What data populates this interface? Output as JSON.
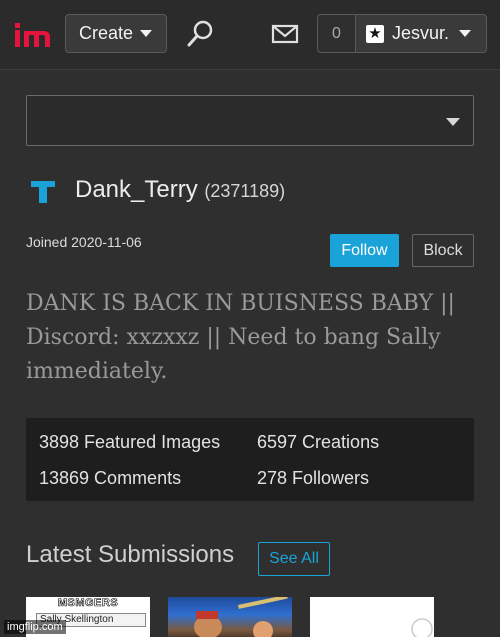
{
  "header": {
    "logo_text": "im",
    "create_label": "Create",
    "notification_count": "0",
    "username": "Jesvur.",
    "star_glyph": "★"
  },
  "stream_select": {
    "value": ""
  },
  "profile": {
    "avatar_letter": "T",
    "name": "Dank_Terry",
    "id": "(2371189)",
    "joined": "Joined 2020-11-06",
    "follow_label": "Follow",
    "block_label": "Block",
    "bio": "DANK IS BACK IN BUISNESS BABY || Discord: xxzxxz || Need to bang Sally immediately."
  },
  "stats": {
    "featured_images": "3898 Featured Images",
    "creations": "6597 Creations",
    "comments": "13869 Comments",
    "followers": "278 Followers"
  },
  "submissions": {
    "title": "Latest Submissions",
    "see_all_label": "See All",
    "thumb1_top": "MSMGERS",
    "thumb1_name": "Sally Skellington"
  },
  "watermark": "imgflip.com",
  "colors": {
    "accent": "#1aa3d8",
    "background": "#2f2f2f",
    "stats_bg": "#1e1e1e",
    "logo_red": "#e5143c"
  }
}
